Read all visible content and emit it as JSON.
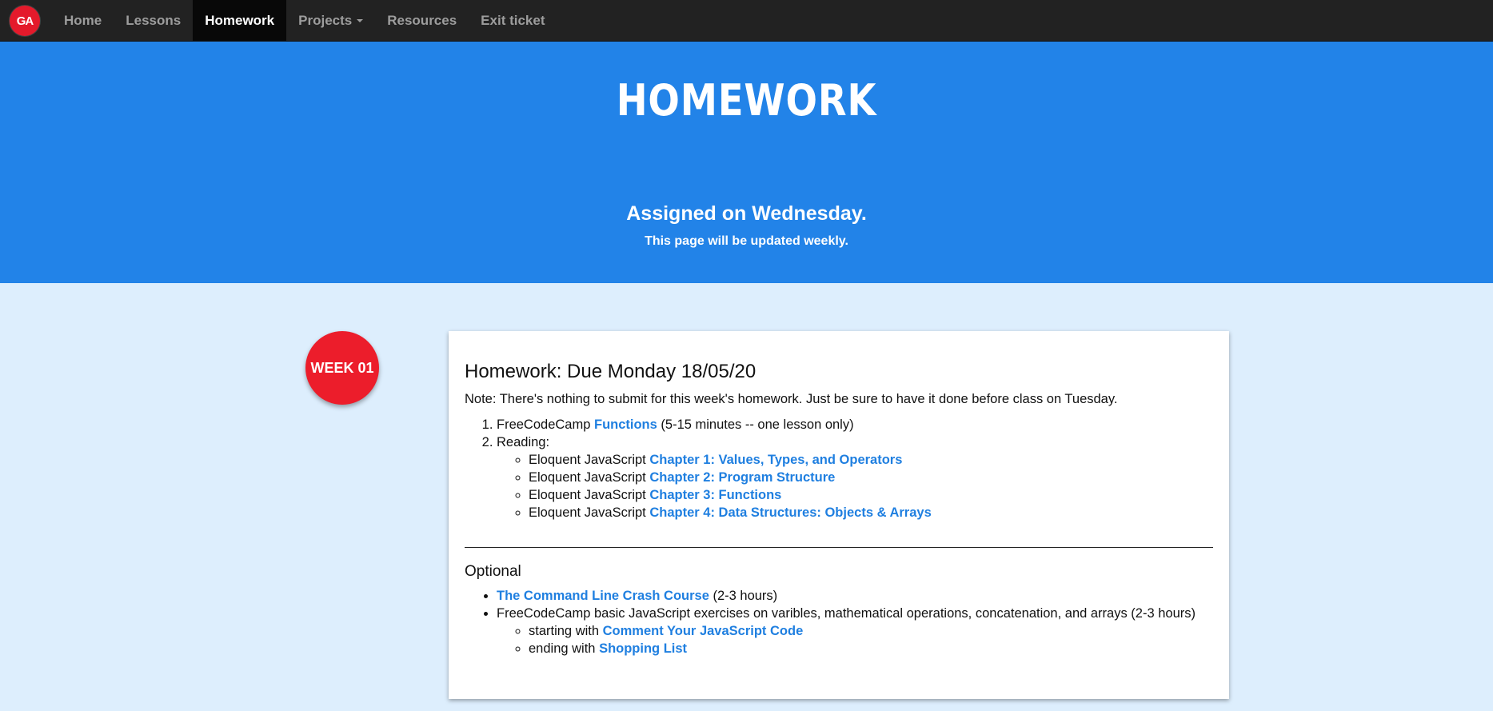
{
  "nav": {
    "logo": "GA",
    "items": [
      {
        "label": "Home"
      },
      {
        "label": "Lessons"
      },
      {
        "label": "Homework"
      },
      {
        "label": "Projects"
      },
      {
        "label": "Resources"
      },
      {
        "label": "Exit ticket"
      }
    ],
    "active": "Homework"
  },
  "hero": {
    "title": "HOMEWORK",
    "subtitle": "Assigned on Wednesday.",
    "note": "This page will be updated weekly."
  },
  "week": {
    "badge": "WEEK 01"
  },
  "homework": {
    "title": "Homework: Due Monday 18/05/20",
    "note": "Note: There's nothing to submit for this week's homework. Just be sure to have it done before class on Tuesday.",
    "item1": {
      "prefix": "FreeCodeCamp ",
      "link": "Functions",
      "suffix": " (5-15 minutes -- one lesson only)"
    },
    "item2": {
      "label": "Reading:",
      "readings": [
        {
          "prefix": "Eloquent JavaScript ",
          "link": "Chapter 1: Values, Types, and Operators"
        },
        {
          "prefix": "Eloquent JavaScript ",
          "link": "Chapter 2: Program Structure"
        },
        {
          "prefix": "Eloquent JavaScript ",
          "link": "Chapter 3: Functions"
        },
        {
          "prefix": "Eloquent JavaScript ",
          "link": "Chapter 4: Data Structures: Objects & Arrays"
        }
      ]
    },
    "optional": {
      "title": "Optional",
      "item1": {
        "link": "The Command Line Crash Course",
        "suffix": " (2-3 hours)"
      },
      "item2": {
        "text": "FreeCodeCamp basic JavaScript exercises on varibles, mathematical operations, concatenation, and arrays (2-3 hours)",
        "start": {
          "prefix": "starting with ",
          "link": "Comment Your JavaScript Code"
        },
        "end": {
          "prefix": "ending with ",
          "link": "Shopping List"
        }
      }
    }
  },
  "colors": {
    "navbar": "#222222",
    "hero": "#2283e8",
    "background": "#ddeefd",
    "badge": "#ec1d2b",
    "link": "#1f7fe0"
  }
}
